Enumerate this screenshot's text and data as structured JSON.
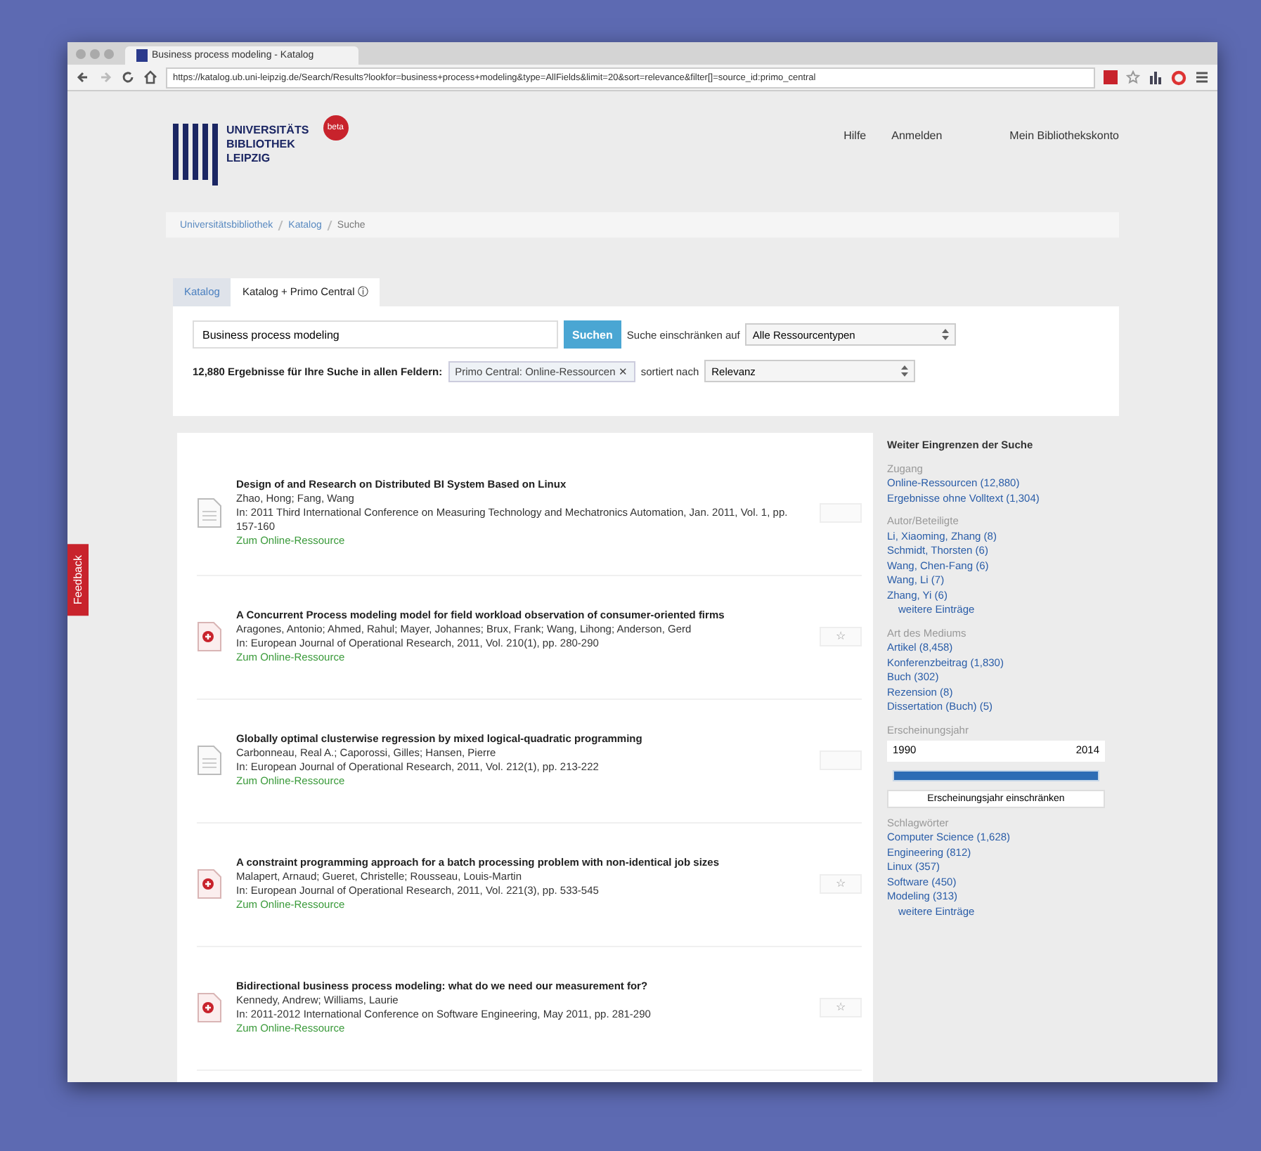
{
  "browser": {
    "tab_title": "Business process modeling - Katalog",
    "url": "https://katalog.ub.uni-leipzig.de/Search/Results?lookfor=business+process+modeling&type=AllFields&limit=20&sort=relevance&filter[]=source_id:primo_central"
  },
  "header": {
    "logo_lines": [
      "UNIVERSITÄTS",
      "BIBLIOTHEK",
      "LEIPZIG"
    ],
    "badge": "beta",
    "nav": [
      "Hilfe",
      "Anmelden",
      "Mein Bibliothekskonto"
    ]
  },
  "breadcrumb": [
    "Universitätsbibliothek",
    "Katalog",
    "Suche"
  ],
  "tabs": [
    {
      "label": "Katalog",
      "selected": false
    },
    {
      "label": "Katalog + Primo Central ⓘ",
      "selected": true
    }
  ],
  "search": {
    "value": "Business process modeling",
    "button": "Suchen",
    "scope_label": "Suche einschränken auf",
    "scope": "Alle Ressourcentypen",
    "results_text": "12,880 Ergebnisse für Ihre Suche in allen Feldern:",
    "filter": "Primo Central: Online-Ressourcen ✕",
    "sort_label": "sortiert nach",
    "sort": "Relevanz"
  },
  "results": [
    {
      "kind": "document",
      "title": "Design of and Research on Distributed BI System Based on Linux",
      "authors": "Zhao, Hong; Fang, Wang",
      "source": "In: 2011 Third International Conference on Measuring Technology and Mechatronics Automation, Jan. 2011, Vol. 1, pp. 157-160",
      "link": "Zum Online-Ressource"
    },
    {
      "kind": "pdf",
      "title": "A Concurrent Process modeling model for field workload observation of consumer-oriented firms",
      "authors": "Aragones, Antonio; Ahmed, Rahul; Mayer, Johannes; Brux, Frank; Wang, Lihong; Anderson, Gerd",
      "source": "In: European Journal of Operational Research, 2011, Vol. 210(1), pp. 280-290",
      "link": "Zum Online-Ressource",
      "action": "☆"
    },
    {
      "kind": "document",
      "title": "Globally optimal clusterwise regression by mixed logical-quadratic programming",
      "authors": "Carbonneau, Real A.; Caporossi, Gilles; Hansen, Pierre",
      "source": "In: European Journal of Operational Research, 2011, Vol. 212(1), pp. 213-222",
      "link": "Zum Online-Ressource"
    },
    {
      "kind": "pdf",
      "title": "A constraint programming approach for a batch processing problem with non-identical job sizes",
      "authors": "Malapert, Arnaud; Gueret, Christelle; Rousseau, Louis-Martin",
      "source": "In: European Journal of Operational Research, 2011, Vol. 221(3), pp. 533-545",
      "link": "Zum Online-Ressource",
      "action": "☆"
    },
    {
      "kind": "pdf",
      "title": "Bidirectional business process modeling: what do we need our measurement for?",
      "authors": "Kennedy, Andrew; Williams, Laurie",
      "source": "In: 2011-2012 International Conference on Software Engineering, May 2011, pp. 281-290",
      "link": "Zum Online-Ressource",
      "action": "☆"
    }
  ],
  "facets": {
    "title": "Weiter Eingrenzen der Suche",
    "groups": [
      {
        "kind": "list",
        "heading": "Zugang",
        "items": [
          "Online-Ressourcen (12,880)",
          "Ergebnisse ohne Volltext (1,304)"
        ]
      },
      {
        "kind": "list",
        "heading": "Autor/Beteiligte",
        "items": [
          "Li, Xiaoming, Zhang (8)",
          "Schmidt, Thorsten (6)",
          "Wang, Chen-Fang (6)",
          "Wang, Li (7)",
          "Zhang, Yi (6)"
        ],
        "more": "weitere Einträge"
      },
      {
        "kind": "list",
        "heading": "Art des Mediums",
        "items": [
          "Artikel (8,458)",
          "Konferenzbeitrag (1,830)",
          "Buch (302)",
          "Rezension (8)",
          "Dissertation (Buch) (5)"
        ]
      },
      {
        "kind": "range",
        "heading": "Erscheinungsjahr",
        "from": "1990",
        "to": "2014",
        "level": 1,
        "button": "Erscheinungsjahr einschränken"
      },
      {
        "kind": "list",
        "heading": "Schlagwörter",
        "items": [
          "Computer Science (1,628)",
          "Engineering (812)",
          "Linux (357)",
          "Software (450)",
          "Modeling (313)"
        ],
        "more": "weitere Einträge"
      }
    ]
  },
  "feedback": "Feedback"
}
